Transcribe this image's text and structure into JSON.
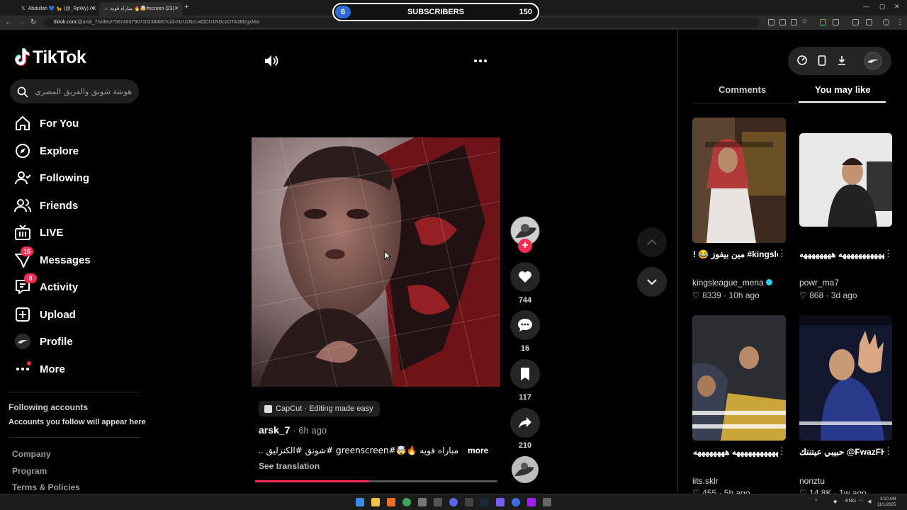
{
  "browser": {
    "tabs": [
      {
        "title": "Abdullah 💙 🐆 (@_RpWy) / X"
      },
      {
        "title": "مباراه قويه 🔥🤯#screen (23)"
      }
    ],
    "url_domain": "tiktok.com",
    "url_rest": "/@arsk_7/video/7567493790710238485?cid=NzU2NzU4ODU1NDczOTA3MzgxMw"
  },
  "stream_overlay": {
    "left_count": "6",
    "label": "SUBSCRIBERS",
    "right_count": "150"
  },
  "sidebar": {
    "logo": "TikTok",
    "search_placeholder": "هوشة شونق والفريق المصري",
    "items": [
      {
        "label": "For You",
        "icon": "home-icon"
      },
      {
        "label": "Explore",
        "icon": "compass-icon"
      },
      {
        "label": "Following",
        "icon": "following-icon"
      },
      {
        "label": "Friends",
        "icon": "friends-icon"
      },
      {
        "label": "LIVE",
        "icon": "live-tv-icon"
      },
      {
        "label": "Messages",
        "icon": "send-icon",
        "badge": "15"
      },
      {
        "label": "Activity",
        "icon": "activity-icon",
        "badge": "8"
      },
      {
        "label": "Upload",
        "icon": "upload-icon"
      },
      {
        "label": "Profile",
        "icon": "avatar"
      },
      {
        "label": "More",
        "icon": "more-dots-icon"
      }
    ],
    "following_title": "Following accounts",
    "following_subtitle": "Accounts you follow will appear here",
    "footer_links": [
      "Company",
      "Program",
      "Terms & Policies"
    ]
  },
  "video": {
    "capcut_label": "CapCut · Editing made easy",
    "author": "arsk_7",
    "posted": "· 6h ago",
    "caption": "مباراه قويه 🔥🤯#greenscreen #شونق #الكنزليق ...",
    "more_label": "more",
    "translate_label": "See translation",
    "progress": 0.47
  },
  "actions": {
    "likes": "744",
    "comments": "16",
    "saves": "117",
    "shares": "210"
  },
  "right_panel": {
    "tabs": [
      "Comments",
      "You may like"
    ],
    "active_tab": "You may like",
    "cards": [
      {
        "title": "!  😂 مين بيفوز #kingsleague...",
        "user": "kingsleague_mena",
        "verified": true,
        "likes": "8339",
        "age": "10h ago"
      },
      {
        "title": "ههههههههههههههههههه ههههههههه...",
        "user": "powr_ma7",
        "verified": false,
        "likes": "868",
        "age": "3d ago"
      },
      {
        "title": "ههههههههههههههههههه ههههههههه #fpy...",
        "user": "iits.sklr",
        "verified": false,
        "likes": "455",
        "age": "5h ago"
      },
      {
        "title": "حبيبي عيتنتك @FwazFH...",
        "user": "nonztu",
        "verified": false,
        "likes": "14.8K",
        "age": "1w ago"
      }
    ]
  },
  "taskbar": {
    "lang": "ENG",
    "time": "8:10 AM",
    "date": "11/1/2025"
  },
  "colors": {
    "accent": "#fe2c55",
    "background": "#000000",
    "verified": "#20d5ec",
    "overlay_blue": "#2a6bd8"
  }
}
